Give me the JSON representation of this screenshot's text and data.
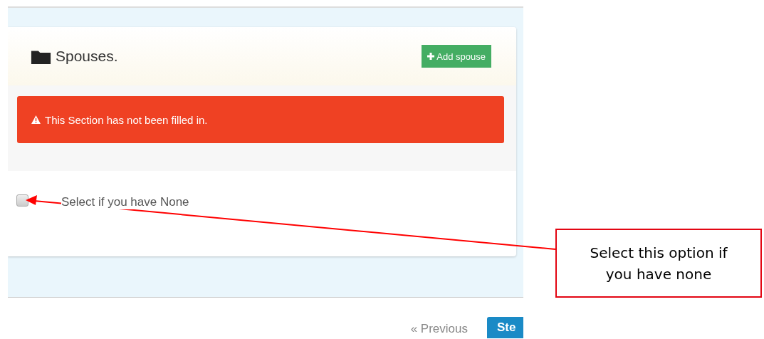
{
  "panel": {
    "title": "Spouses.",
    "add_button": "Add spouse",
    "alert": "This Section has not been filled in.",
    "none_option": {
      "label": "Select if you have None",
      "checked": false
    }
  },
  "pager": {
    "previous": "« Previous",
    "next": "Ste"
  },
  "callout": {
    "text": "Select this option if you have none"
  }
}
